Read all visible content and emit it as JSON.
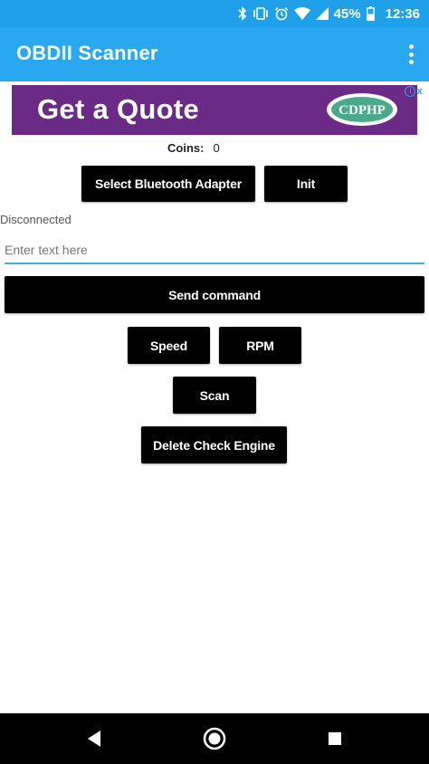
{
  "status_bar": {
    "battery_percent": "45%",
    "time": "12:36",
    "icons": [
      "bluetooth-icon",
      "vibrate-icon",
      "alarm-icon",
      "wifi-icon",
      "signal-icon",
      "battery-icon"
    ],
    "background": "#1fa0e8"
  },
  "app_bar": {
    "title": "OBDII Scanner",
    "background": "#29a8ef",
    "menu_icon": "overflow-menu-icon"
  },
  "ad": {
    "headline": "Get a Quote",
    "logo_text": "CDPHP",
    "background": "#6a2a86",
    "close_label": "x"
  },
  "coins": {
    "label": "Coins:",
    "value": "0"
  },
  "buttons": {
    "select_adapter": "Select Bluetooth Adapter",
    "init": "Init",
    "send_command": "Send command",
    "speed": "Speed",
    "rpm": "RPM",
    "scan": "Scan",
    "delete_check_engine": "Delete Check Engine"
  },
  "connection_status": "Disconnected",
  "command_input": {
    "placeholder": "Enter text here",
    "value": ""
  },
  "nav_bar": {
    "icons": [
      "back-icon",
      "home-icon",
      "recents-icon"
    ]
  }
}
